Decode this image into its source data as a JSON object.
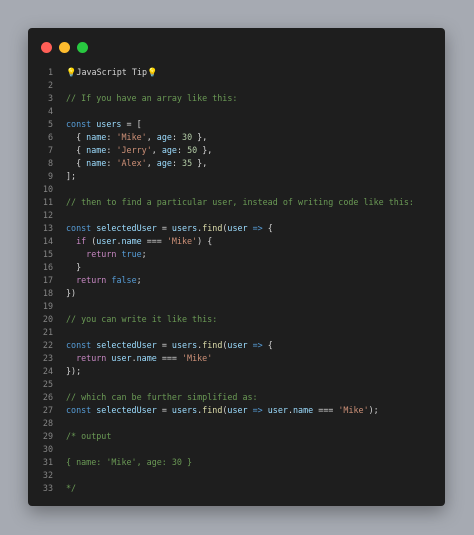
{
  "window": {
    "controls": [
      "close",
      "minimize",
      "maximize"
    ],
    "colors": {
      "close": "#ff5f57",
      "minimize": "#febc2e",
      "maximize": "#28c840"
    }
  },
  "editor": {
    "lines": [
      [
        [
          "tip",
          "💡JavaScript Tip💡"
        ]
      ],
      [],
      [
        [
          "cm",
          "// If you have an array like this:"
        ]
      ],
      [],
      [
        [
          "kw",
          "const"
        ],
        [
          "pl",
          " "
        ],
        [
          "var",
          "users"
        ],
        [
          "pl",
          " = ["
        ]
      ],
      [
        [
          "pl",
          "  { "
        ],
        [
          "var",
          "name"
        ],
        [
          "pl",
          ": "
        ],
        [
          "str",
          "'Mike'"
        ],
        [
          "pl",
          ", "
        ],
        [
          "var",
          "age"
        ],
        [
          "pl",
          ": "
        ],
        [
          "num",
          "30"
        ],
        [
          "pl",
          " },"
        ]
      ],
      [
        [
          "pl",
          "  { "
        ],
        [
          "var",
          "name"
        ],
        [
          "pl",
          ": "
        ],
        [
          "str",
          "'Jerry'"
        ],
        [
          "pl",
          ", "
        ],
        [
          "var",
          "age"
        ],
        [
          "pl",
          ": "
        ],
        [
          "num",
          "50"
        ],
        [
          "pl",
          " },"
        ]
      ],
      [
        [
          "pl",
          "  { "
        ],
        [
          "var",
          "name"
        ],
        [
          "pl",
          ": "
        ],
        [
          "str",
          "'Alex'"
        ],
        [
          "pl",
          ", "
        ],
        [
          "var",
          "age"
        ],
        [
          "pl",
          ": "
        ],
        [
          "num",
          "35"
        ],
        [
          "pl",
          " },"
        ]
      ],
      [
        [
          "pl",
          "];"
        ]
      ],
      [],
      [
        [
          "cm",
          "// then to find a particular user, instead of writing code like this:"
        ]
      ],
      [],
      [
        [
          "kw",
          "const"
        ],
        [
          "pl",
          " "
        ],
        [
          "var",
          "selectedUser"
        ],
        [
          "pl",
          " = "
        ],
        [
          "var",
          "users"
        ],
        [
          "pl",
          "."
        ],
        [
          "fn",
          "find"
        ],
        [
          "pl",
          "("
        ],
        [
          "var",
          "user"
        ],
        [
          "pl",
          " "
        ],
        [
          "kw",
          "=>"
        ],
        [
          "pl",
          " {"
        ]
      ],
      [
        [
          "pl",
          "  "
        ],
        [
          "ctl",
          "if"
        ],
        [
          "pl",
          " ("
        ],
        [
          "var",
          "user"
        ],
        [
          "pl",
          "."
        ],
        [
          "var",
          "name"
        ],
        [
          "pl",
          " === "
        ],
        [
          "str",
          "'Mike'"
        ],
        [
          "pl",
          ") {"
        ]
      ],
      [
        [
          "pl",
          "    "
        ],
        [
          "ctl",
          "return"
        ],
        [
          "pl",
          " "
        ],
        [
          "kw",
          "true"
        ],
        [
          "pl",
          ";"
        ]
      ],
      [
        [
          "pl",
          "  }"
        ]
      ],
      [
        [
          "pl",
          "  "
        ],
        [
          "ctl",
          "return"
        ],
        [
          "pl",
          " "
        ],
        [
          "kw",
          "false"
        ],
        [
          "pl",
          ";"
        ]
      ],
      [
        [
          "pl",
          "})"
        ]
      ],
      [],
      [
        [
          "cm",
          "// you can write it like this:"
        ]
      ],
      [],
      [
        [
          "kw",
          "const"
        ],
        [
          "pl",
          " "
        ],
        [
          "var",
          "selectedUser"
        ],
        [
          "pl",
          " = "
        ],
        [
          "var",
          "users"
        ],
        [
          "pl",
          "."
        ],
        [
          "fn",
          "find"
        ],
        [
          "pl",
          "("
        ],
        [
          "var",
          "user"
        ],
        [
          "pl",
          " "
        ],
        [
          "kw",
          "=>"
        ],
        [
          "pl",
          " {"
        ]
      ],
      [
        [
          "pl",
          "  "
        ],
        [
          "ctl",
          "return"
        ],
        [
          "pl",
          " "
        ],
        [
          "var",
          "user"
        ],
        [
          "pl",
          "."
        ],
        [
          "var",
          "name"
        ],
        [
          "pl",
          " === "
        ],
        [
          "str",
          "'Mike'"
        ]
      ],
      [
        [
          "pl",
          "});"
        ]
      ],
      [],
      [
        [
          "cm",
          "// which can be further simplified as:"
        ]
      ],
      [
        [
          "kw",
          "const"
        ],
        [
          "pl",
          " "
        ],
        [
          "var",
          "selectedUser"
        ],
        [
          "pl",
          " = "
        ],
        [
          "var",
          "users"
        ],
        [
          "pl",
          "."
        ],
        [
          "fn",
          "find"
        ],
        [
          "pl",
          "("
        ],
        [
          "var",
          "user"
        ],
        [
          "pl",
          " "
        ],
        [
          "kw",
          "=>"
        ],
        [
          "pl",
          " "
        ],
        [
          "var",
          "user"
        ],
        [
          "pl",
          "."
        ],
        [
          "var",
          "name"
        ],
        [
          "pl",
          " === "
        ],
        [
          "str",
          "'Mike'"
        ],
        [
          "pl",
          ");"
        ]
      ],
      [],
      [
        [
          "cm",
          "/* output"
        ]
      ],
      [],
      [
        [
          "cm",
          "{ name: 'Mike', age: 30 }"
        ]
      ],
      [],
      [
        [
          "cm",
          "*/"
        ]
      ]
    ]
  }
}
